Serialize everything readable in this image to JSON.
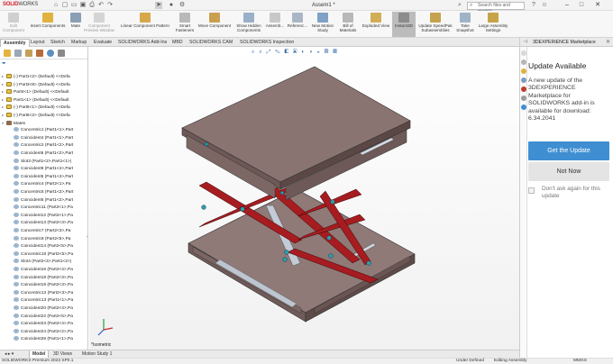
{
  "app": {
    "brand": "SOLIDWORKS",
    "doc_title": "Assem1 *"
  },
  "search": {
    "placeholder": "Search files and models"
  },
  "ribbon": [
    {
      "label": "Edit\nComponent",
      "dim": true
    },
    {
      "label": "Insert Components"
    },
    {
      "label": "Mate"
    },
    {
      "label": "Component\nPreview Window",
      "dim": true
    },
    {
      "label": "Linear Component Pattern"
    },
    {
      "label": "Smart\nFasteners"
    },
    {
      "label": "Move Component"
    },
    {
      "label": "Show Hidden\nComponents"
    },
    {
      "label": "Assemb..."
    },
    {
      "label": "Referenc..."
    },
    {
      "label": "New Motion\nStudy"
    },
    {
      "label": "Bill of\nMaterials"
    },
    {
      "label": "Exploded View"
    },
    {
      "label": "Instant3D",
      "active": true
    },
    {
      "label": "Update SpeedPak\nSubassemblies"
    },
    {
      "label": "Take\nSnapshot"
    },
    {
      "label": "Large Assembly\nSettings"
    }
  ],
  "tabs": [
    "Assembly",
    "Layout",
    "Sketch",
    "Markup",
    "Evaluate",
    "SOLIDWORKS Add-Ins",
    "MBD",
    "SOLIDWORKS CAM",
    "SOLIDWORKS Inspection"
  ],
  "tree": [
    {
      "label": "(-) Part1<2> (Default) <<Defa",
      "kind": "part",
      "arrow": "▸"
    },
    {
      "label": "(-) Part3<8> (Default) <<Defa",
      "kind": "part",
      "arrow": "▸"
    },
    {
      "label": "Part4<1> (Default) <<Default",
      "kind": "part",
      "arrow": "▸"
    },
    {
      "label": "Part1<1> (Default) <<Default",
      "kind": "part",
      "arrow": "▸"
    },
    {
      "label": "(-) Part6<1> (Default) <<Defa",
      "kind": "part",
      "arrow": "▸"
    },
    {
      "label": "(-) Part6<2> (Default) <<Defa",
      "kind": "part",
      "arrow": "▸"
    },
    {
      "label": "Mates",
      "kind": "mates",
      "arrow": "▾"
    },
    {
      "label": "Concentric1 (Part1<1>,Part",
      "kind": "mate"
    },
    {
      "label": "Coincident4 (Part1<1>,Part",
      "kind": "mate"
    },
    {
      "label": "Concentric2 (Part1<2>,Part",
      "kind": "mate"
    },
    {
      "label": "Coincident6 (Part1<2>,Part",
      "kind": "mate"
    },
    {
      "label": "Slot3 (Part1<2>,Part1<1>)",
      "kind": "mate"
    },
    {
      "label": "Coincident9 (Part1<4>,Part",
      "kind": "mate"
    },
    {
      "label": "Coincident5 (Part1<4>,Part",
      "kind": "mate"
    },
    {
      "label": "Concentric4 (Part2<1>,Pa",
      "kind": "mate"
    },
    {
      "label": "Concentric5 (Part1<2>,Part",
      "kind": "mate"
    },
    {
      "label": "Coincident6 (Part1<2>,Part",
      "kind": "mate"
    },
    {
      "label": "Concentric11 (Part2<1>,Pa",
      "kind": "mate"
    },
    {
      "label": "Coincident12 (Part2<1>,Pa",
      "kind": "mate"
    },
    {
      "label": "Coincident13 (Part2<3>,Pa",
      "kind": "mate"
    },
    {
      "label": "Concentric7 (Part2<3>,Pa",
      "kind": "mate"
    },
    {
      "label": "Concentric8 (Part2<5>,Pa",
      "kind": "mate"
    },
    {
      "label": "Coincident14 (Part2<5>,Pa",
      "kind": "mate"
    },
    {
      "label": "Concentric10 (Part2<5>,Pa",
      "kind": "mate"
    },
    {
      "label": "Slot4 (Part2<4>,Part1<2>)",
      "kind": "mate"
    },
    {
      "label": "Coincident16 (Part2<4>,Pa",
      "kind": "mate"
    },
    {
      "label": "Coincident18 (Part2<3>,Pa",
      "kind": "mate"
    },
    {
      "label": "Coincident19 (Part2<3>,Pa",
      "kind": "mate"
    },
    {
      "label": "Concentric12 (Part2<3>,Pa",
      "kind": "mate"
    },
    {
      "label": "Concentric13 (Part1<1>,Pa",
      "kind": "mate"
    },
    {
      "label": "Coincident20 (Part2<4>,Pa",
      "kind": "mate"
    },
    {
      "label": "Coincident22 (Part2<5>,Pa",
      "kind": "mate"
    },
    {
      "label": "Coincident23 (Part2<4>,Pa",
      "kind": "mate"
    },
    {
      "label": "Coincident24 (Part2<2>,Pa",
      "kind": "mate"
    },
    {
      "label": "Coincident28 (Part1<1>,Pa",
      "kind": "mate"
    }
  ],
  "viewport": {
    "view_label": "*Isometric"
  },
  "bottom_tabs": [
    "Model",
    "3D Views",
    "Motion Study 1"
  ],
  "status": {
    "left": "SOLIDWORKS Premium 2023 SP0.1",
    "under_defined": "Under Defined",
    "editing": "Editing Assembly",
    "units": "MMGS"
  },
  "right_panel": {
    "header": "3DEXPERIENCE Marketplace",
    "title": "Update Available",
    "body": "A new update of the 3DEXPERIENCE Marketplace for SOLIDWORKS add-in is available for download: 6.34.2041",
    "primary_button": "Get the Update",
    "secondary_button": "Not Now",
    "checkbox_label": "Don't ask again for this update"
  },
  "colors": {
    "accent_blue": "#3f8ed2",
    "plate": "#8a7472",
    "scissor_arm": "#a61c20",
    "rod": "#b7c0cc",
    "brand_red": "#d62128"
  }
}
